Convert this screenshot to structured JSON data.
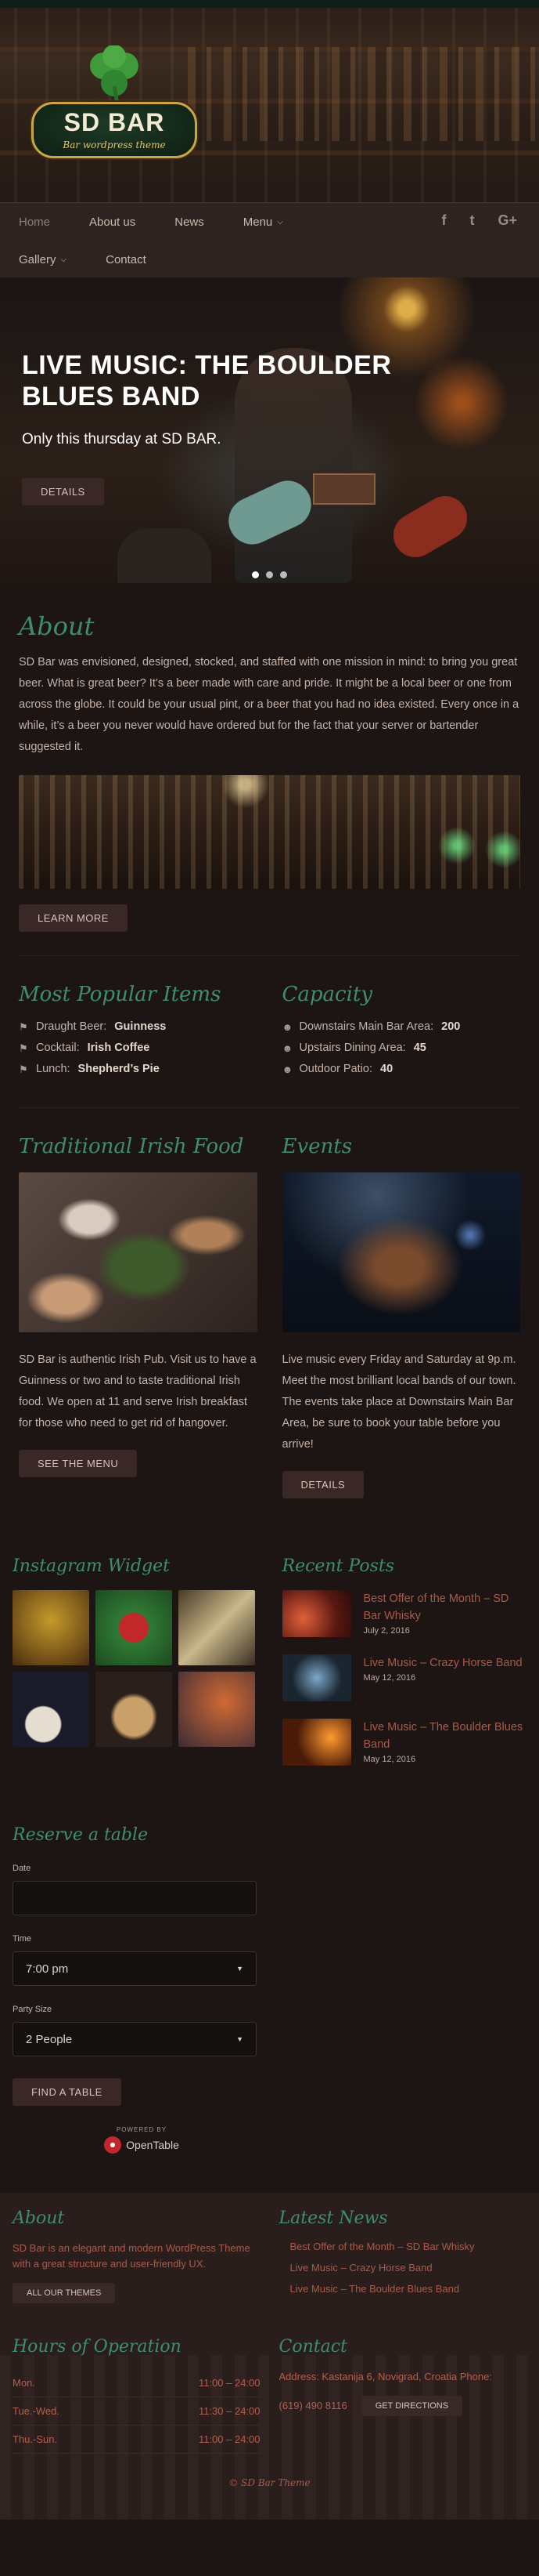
{
  "logo": {
    "title": "SD BAR",
    "subtitle": "Bar wordpress theme"
  },
  "nav": {
    "row1": [
      "Home",
      "About us",
      "News",
      "Menu"
    ],
    "row2": [
      "Gallery",
      "Contact"
    ],
    "social_icons": [
      "facebook-icon",
      "twitter-icon",
      "google-plus-icon"
    ],
    "social_labels": [
      "f",
      "t",
      "G+"
    ]
  },
  "hero": {
    "title": "LIVE MUSIC: THE BOULDER BLUES BAND",
    "subtitle": "Only this thursday at SD BAR.",
    "button": "DETAILS"
  },
  "about": {
    "heading": "About",
    "text": "SD Bar was envisioned, designed, stocked, and staffed with one mission in mind: to bring you great beer. What is great beer? It’s a beer made with care and pride. It might be a local beer or one from across the globe. It could be your usual pint, or a beer that you had no idea existed. Every once in a while, it’s a beer you never would have ordered but for the fact that your server or bartender suggested it.",
    "button": "LEARN MORE"
  },
  "popular": {
    "heading": "Most Popular Items",
    "items": [
      {
        "label": "Draught Beer:",
        "value": "Guinness"
      },
      {
        "label": "Cocktail:",
        "value": "Irish Coffee"
      },
      {
        "label": "Lunch:",
        "value": "Shepherd’s Pie"
      }
    ]
  },
  "capacity": {
    "heading": "Capacity",
    "items": [
      {
        "label": "Downstairs Main Bar Area:",
        "value": "200"
      },
      {
        "label": "Upstairs Dining Area:",
        "value": "45"
      },
      {
        "label": "Outdoor Patio:",
        "value": "40"
      }
    ]
  },
  "food": {
    "heading": "Traditional Irish Food",
    "text": "SD Bar is authentic Irish Pub. Visit us to have a Guinness or two and to taste traditional Irish food. We open at 11 and serve Irish breakfast for those who need to get rid of hangover.",
    "button": "SEE THE MENU"
  },
  "events": {
    "heading": "Events",
    "text": "Live music every Friday and Saturday at 9p.m. Meet the most brilliant local bands of our town. The events take place at Downstairs Main Bar Area, be sure to book your table before you arrive!",
    "button": "DETAILS"
  },
  "instagram": {
    "heading": "Instagram Widget"
  },
  "recent": {
    "heading": "Recent Posts",
    "posts": [
      {
        "title": "Best Offer of the Month – SD Bar Whisky",
        "date": "July 2, 2016"
      },
      {
        "title": "Live Music – Crazy Horse Band",
        "date": "May 12, 2016"
      },
      {
        "title": "Live Music – The Boulder Blues Band",
        "date": "May 12, 2016"
      }
    ]
  },
  "reserve": {
    "heading": "Reserve a table",
    "date_label": "Date",
    "date_value": "",
    "time_label": "Time",
    "time_value": "7:00 pm",
    "party_label": "Party Size",
    "party_value": "2 People",
    "button": "FIND A TABLE",
    "powered_by": "POWERED BY",
    "brand": "OpenTable"
  },
  "footer": {
    "about_heading": "About",
    "about_text": "SD Bar is an elegant and modern WordPress Theme with a great structure and user-friendly UX.",
    "about_button": "ALL OUR THEMES",
    "news_heading": "Latest News",
    "news": [
      "Best Offer of the Month – SD Bar Whisky",
      "Live Music – Crazy Horse Band",
      "Live Music – The Boulder Blues Band"
    ],
    "hours_heading": "Hours of Operation",
    "hours": [
      {
        "day": "Mon.",
        "time": "11:00 – 24:00"
      },
      {
        "day": "Tue.-Wed.",
        "time": "11:30 – 24:00"
      },
      {
        "day": "Thu.-Sun.",
        "time": "11:00 – 24:00"
      }
    ],
    "contact_heading": "Contact",
    "address": "Address: Kastanija 6, Novigrad, Croatia Phone:",
    "phone": "(619) 490 8116",
    "directions_button": "GET DIRECTIONS",
    "copyright": "© SD Bar Theme"
  }
}
